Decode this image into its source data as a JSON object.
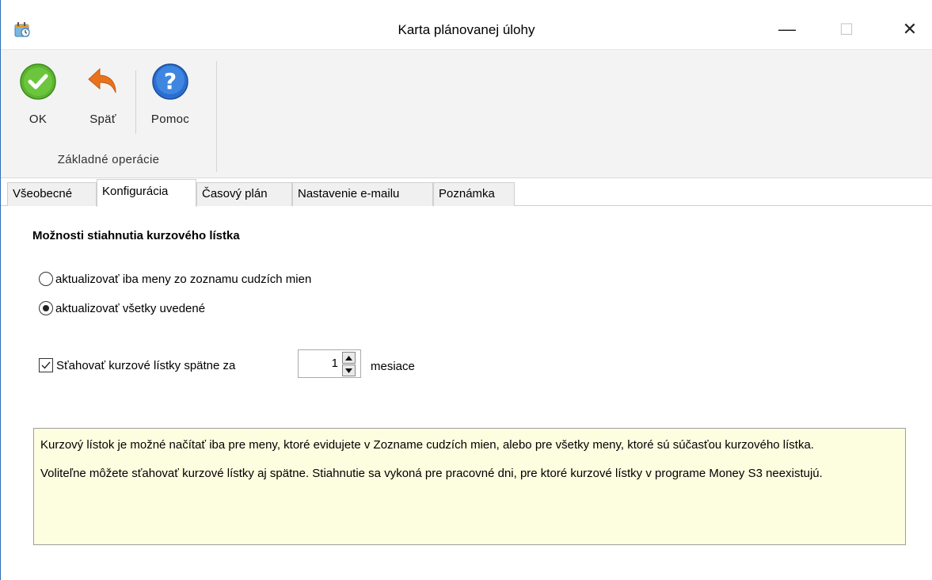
{
  "window": {
    "title": "Karta plánovanej úlohy",
    "minimize_glyph": "—",
    "maximize_glyph": "☐",
    "close_glyph": "✕"
  },
  "ribbon": {
    "ok_label": "OK",
    "back_label": "Späť",
    "help_label": "Pomoc",
    "group_label": "Základné operácie",
    "icons": [
      "check-circle-icon",
      "undo-arrow-icon",
      "help-circle-icon"
    ]
  },
  "tabs": [
    {
      "label": "Všeobecné",
      "active": false
    },
    {
      "label": "Konfigurácia",
      "active": true
    },
    {
      "label": "Časový plán",
      "active": false
    },
    {
      "label": "Nastavenie e-mailu",
      "active": false
    },
    {
      "label": "Poznámka",
      "active": false
    }
  ],
  "config": {
    "heading": "Možnosti stiahnutia kurzového lístka",
    "radio_options": [
      {
        "label": "aktualizovať iba meny zo zoznamu cudzích mien",
        "selected": false
      },
      {
        "label": "aktualizovať všetky uvedené",
        "selected": true
      }
    ],
    "download_back": {
      "label": "Sťahovať kurzové lístky spätne za",
      "checked": true,
      "value": "1",
      "unit": "mesiace"
    },
    "info": {
      "paragraph1": "Kurzový lístok je možné načítať iba pre meny, ktoré evidujete v Zozname cudzích mien, alebo pre všetky meny, ktoré sú súčasťou kurzového lístka.",
      "paragraph2": "Voliteľne môžete sťahovať kurzové lístky aj spätne. Stiahnutie sa vykoná pre pracovné dni, pre ktoré kurzové lístky v programe Money S3 neexistujú."
    }
  },
  "colors": {
    "ok_green": "#5cb531",
    "back_orange": "#e8731f",
    "help_blue": "#2a6fd0",
    "info_bg": "#fdfde0",
    "window_border": "#2b6fb6"
  }
}
